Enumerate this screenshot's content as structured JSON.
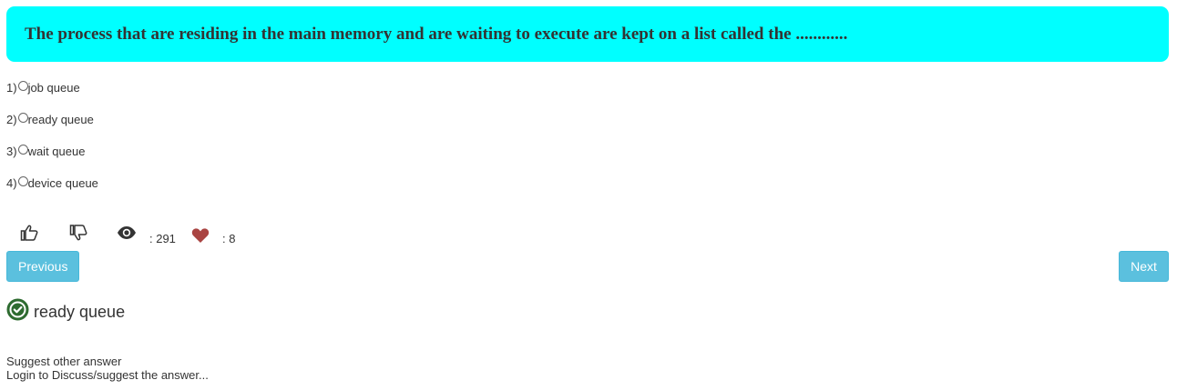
{
  "question": {
    "text": "The process that are residing in the main memory and are waiting to execute are kept on a list called the ............"
  },
  "options": [
    {
      "number": "1)",
      "label": "job queue"
    },
    {
      "number": "2)",
      "label": "ready queue"
    },
    {
      "number": "3)",
      "label": "wait queue"
    },
    {
      "number": "4)",
      "label": "device queue"
    }
  ],
  "stats": {
    "views": ": 291",
    "likes": ": 8"
  },
  "icons": {
    "like": "thumbs-up-icon",
    "dislike": "thumbs-down-icon",
    "views": "eye-icon",
    "favorite": "heart-icon",
    "answer": "check-circle-icon"
  },
  "navigation": {
    "previous_label": "Previous",
    "next_label": "Next"
  },
  "answer": {
    "text": "ready queue"
  },
  "links": {
    "suggest": "Suggest other answer",
    "login": "Login to Discuss/suggest the answer..."
  },
  "colors": {
    "question_bg": "#00ffff",
    "button_bg": "#5bc0de",
    "heart": "#a94442",
    "check": "#2e6b30",
    "text": "#333333"
  }
}
